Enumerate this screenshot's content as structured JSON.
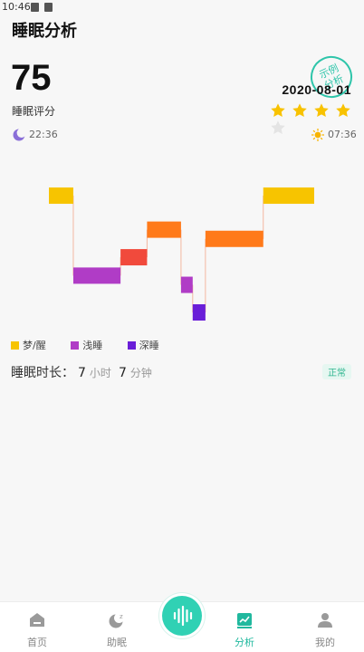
{
  "status_bar": {
    "time": "10:46"
  },
  "header": {
    "title": "睡眠分析"
  },
  "summary": {
    "score": "75",
    "score_label": "睡眠评分",
    "stamp_line1": "示例",
    "stamp_line2": "分析",
    "date": "2020-08-01",
    "rating": 4,
    "rating_max": 5,
    "sleep_time": "22:36",
    "wake_time": "07:36"
  },
  "chart_data": {
    "type": "hypnogram",
    "stages": [
      "梦/醒",
      "浅睡",
      "深睡"
    ],
    "colors": {
      "dream": "#f7c400",
      "light": "#b03cc6",
      "deep": "#6a1ed8",
      "orange": "#ff7a1a",
      "red": "#f14a3c"
    },
    "segments": [
      {
        "start": 0.0,
        "end": 0.092,
        "level": 0.97,
        "color": "dream"
      },
      {
        "start": 0.092,
        "end": 0.27,
        "level": 0.1,
        "color": "light"
      },
      {
        "start": 0.27,
        "end": 0.37,
        "level": 0.3,
        "color": "red"
      },
      {
        "start": 0.37,
        "end": 0.498,
        "level": 0.6,
        "color": "orange"
      },
      {
        "start": 0.498,
        "end": 0.542,
        "level": 0.0,
        "color": "light"
      },
      {
        "start": 0.542,
        "end": 0.59,
        "level": -0.3,
        "color": "deep"
      },
      {
        "start": 0.59,
        "end": 0.808,
        "level": 0.5,
        "color": "orange"
      },
      {
        "start": 0.808,
        "end": 1.0,
        "level": 0.97,
        "color": "dream"
      }
    ]
  },
  "legend": [
    {
      "label": "梦/醒",
      "color": "#f7c400"
    },
    {
      "label": "浅睡",
      "color": "#b03cc6"
    },
    {
      "label": "深睡",
      "color": "#6a1ed8"
    }
  ],
  "duration": {
    "label": "睡眠时长：",
    "hours": "7",
    "hours_unit": "小时",
    "minutes": "7",
    "minutes_unit": "分钟",
    "status": "正常"
  },
  "tabbar": {
    "tabs": [
      {
        "label": "首页",
        "icon": "home-icon"
      },
      {
        "label": "助眠",
        "icon": "moon-zz-icon"
      },
      {
        "label": "",
        "icon": "sound-wave-icon"
      },
      {
        "label": "分析",
        "icon": "chart-icon"
      },
      {
        "label": "我的",
        "icon": "person-icon"
      }
    ],
    "active_color": "#20b89e"
  }
}
